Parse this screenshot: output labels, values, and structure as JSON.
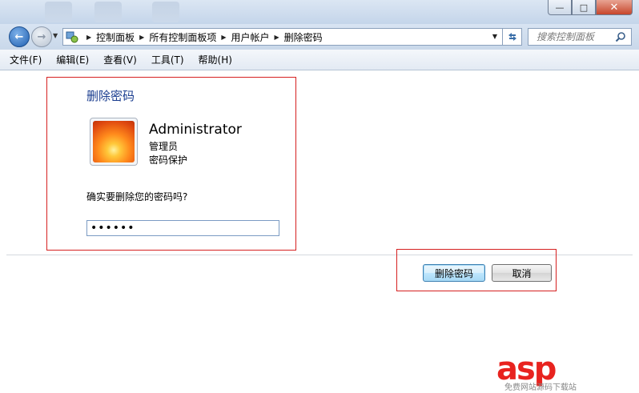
{
  "window": {
    "controls": {
      "minimize_glyph": "—",
      "maximize_glyph": "□",
      "close_glyph": "✕"
    }
  },
  "address": {
    "crumbs": [
      "控制面板",
      "所有控制面板项",
      "用户帐户",
      "删除密码"
    ]
  },
  "search": {
    "placeholder": "搜索控制面板"
  },
  "menu": {
    "items": [
      "文件(F)",
      "编辑(E)",
      "查看(V)",
      "工具(T)",
      "帮助(H)"
    ]
  },
  "content": {
    "title": "删除密码",
    "user": {
      "name": "Administrator",
      "role": "管理员",
      "protection": "密码保护"
    },
    "question": "确实要删除您的密码吗?",
    "password_value": "••••••"
  },
  "buttons": {
    "delete_label": "删除密码",
    "cancel_label": "取消"
  },
  "watermark": {
    "logo": "asp",
    "subtitle": "免费网站源码下载站"
  },
  "colors": {
    "highlight_box": "#d62020",
    "title_blue": "#1a3d8f"
  }
}
